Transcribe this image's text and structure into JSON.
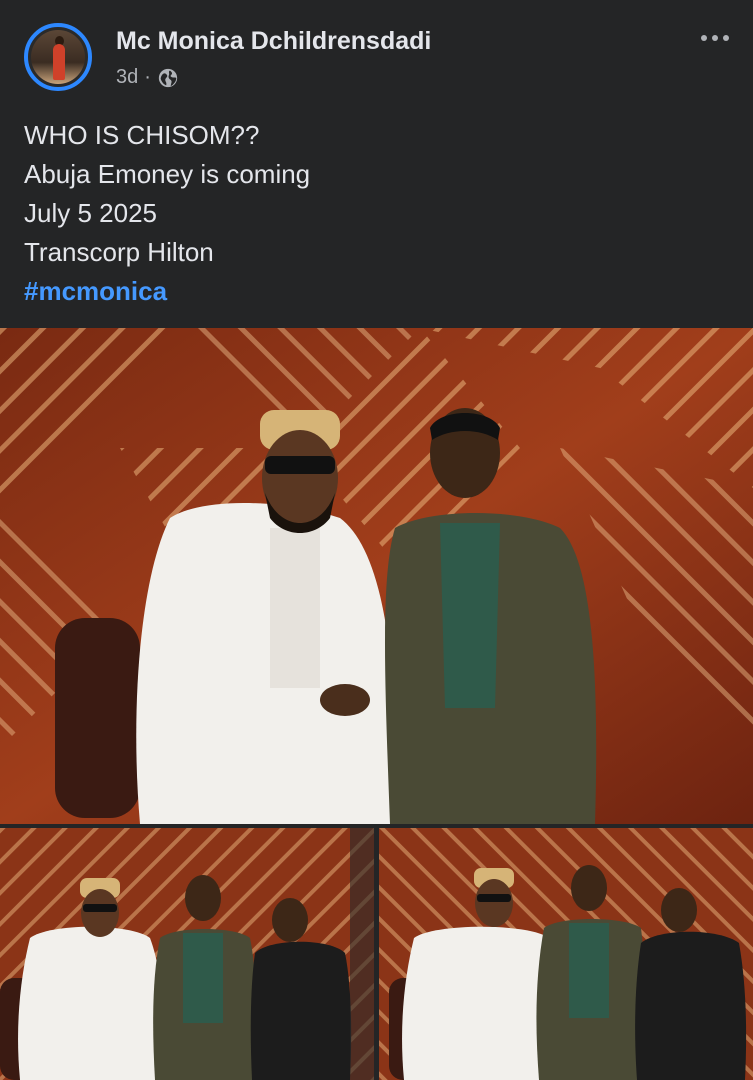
{
  "post": {
    "author": "Mc Monica Dchildrensdadi",
    "time": "3d",
    "separator": "·",
    "audience_icon": "globe-icon",
    "more_icon": "more-options-icon",
    "text_lines": [
      "WHO IS CHISOM??",
      "Abuja Emoney is coming",
      "July 5 2025",
      "Transcorp Hilton"
    ],
    "hashtag": "#mcmonica"
  },
  "colors": {
    "background": "#242526",
    "primary_text": "#e4e6eb",
    "secondary_text": "#b0b3b8",
    "link": "#4599ff",
    "avatar_ring": "#2d88ff"
  }
}
